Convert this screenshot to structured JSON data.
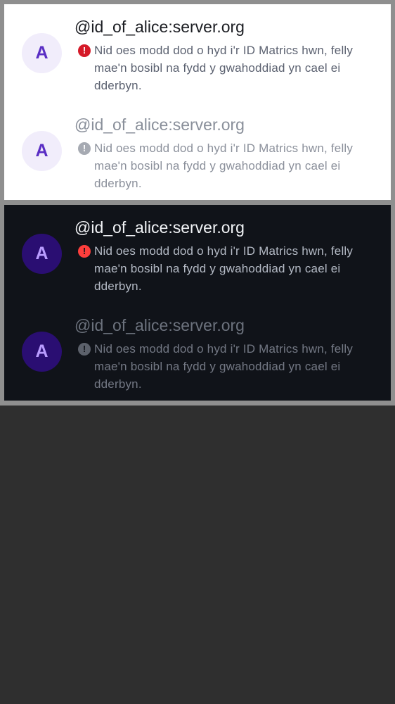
{
  "light": {
    "rows": [
      {
        "avatar_letter": "A",
        "title": "@id_of_alice:server.org",
        "icon": "error-icon",
        "message": "Nid oes modd dod o hyd i'r ID Matrics hwn, felly mae'n bosibl na fydd y gwahoddiad yn cael ei dderbyn."
      },
      {
        "avatar_letter": "A",
        "title": "@id_of_alice:server.org",
        "icon": "error-icon",
        "message": "Nid oes modd dod o hyd i'r ID Matrics hwn, felly mae'n bosibl na fydd y gwahoddiad yn cael ei dderbyn."
      }
    ]
  },
  "dark": {
    "rows": [
      {
        "avatar_letter": "A",
        "title": "@id_of_alice:server.org",
        "icon": "error-icon",
        "message": "Nid oes modd dod o hyd i'r ID Matrics hwn, felly mae'n bosibl na fydd y gwahoddiad yn cael ei dderbyn."
      },
      {
        "avatar_letter": "A",
        "title": "@id_of_alice:server.org",
        "icon": "error-icon",
        "message": "Nid oes modd dod o hyd i'r ID Matrics hwn, felly mae'n bosibl na fydd y gwahoddiad yn cael ei dderbyn."
      }
    ]
  },
  "colors": {
    "light_background": "#ffffff",
    "dark_background": "#101319",
    "error_light": "#d51928",
    "error_dark": "#fd3e3c",
    "avatar_text_light": "#5a2ec4",
    "avatar_text_dark": "#b99cff"
  }
}
